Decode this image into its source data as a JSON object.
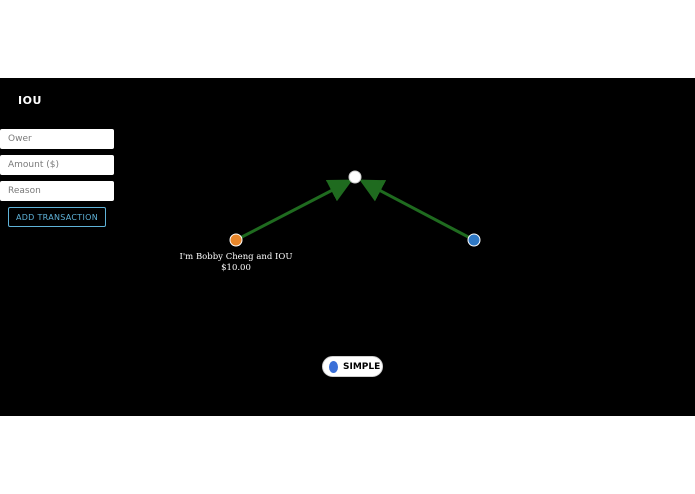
{
  "app": {
    "title": "IOU"
  },
  "form": {
    "ower_placeholder": "Ower",
    "amount_placeholder": "Amount ($)",
    "reason_placeholder": "Reason",
    "add_button_label": "ADD TRANSACTION"
  },
  "graph": {
    "nodes": [
      {
        "id": "left",
        "color": "#e8862a",
        "label": [
          "I'm Bobby Cheng and IOU",
          "$10.00"
        ]
      },
      {
        "id": "center",
        "color": "#ffffff",
        "label": []
      },
      {
        "id": "right",
        "color": "#2f78c4",
        "label": []
      }
    ],
    "edges": [
      {
        "from": "left",
        "to": "center",
        "color": "#1f6b1f"
      },
      {
        "from": "right",
        "to": "center",
        "color": "#1f6b1f"
      }
    ]
  },
  "toggle": {
    "label": "SIMPLE",
    "knob_color": "#3a6fd8"
  }
}
